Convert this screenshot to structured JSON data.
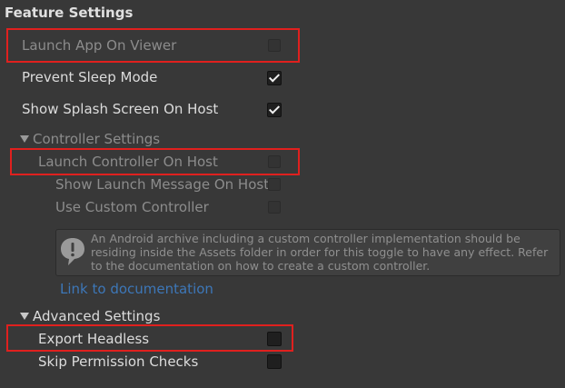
{
  "section_title": "Feature Settings",
  "rows": {
    "launch_app_on_viewer": {
      "label": "Launch App On Viewer",
      "checked": false,
      "enabled": false
    },
    "prevent_sleep_mode": {
      "label": "Prevent Sleep Mode",
      "checked": true,
      "enabled": true
    },
    "show_splash_screen": {
      "label": "Show Splash Screen On Host",
      "checked": true,
      "enabled": true
    },
    "launch_controller_on_host": {
      "label": "Launch Controller On Host",
      "checked": false,
      "enabled": false
    },
    "show_launch_message": {
      "label": "Show Launch Message On Host",
      "checked": false,
      "enabled": false
    },
    "use_custom_controller": {
      "label": "Use Custom Controller",
      "checked": false,
      "enabled": false
    },
    "export_headless": {
      "label": "Export Headless",
      "checked": false,
      "enabled": true
    },
    "skip_permission_checks": {
      "label": "Skip Permission Checks",
      "checked": false,
      "enabled": true
    }
  },
  "controller_settings": {
    "label": "Controller Settings",
    "expanded": true
  },
  "advanced_settings": {
    "label": "Advanced Settings",
    "expanded": true
  },
  "helpbox": {
    "icon": "info-icon",
    "text": "An Android archive including a custom controller implementation should be residing inside the Assets folder in order for this toggle to have any effect. Refer to the documentation on how to create a custom controller."
  },
  "link_text": "Link to documentation",
  "colors": {
    "highlight": "#e0201e",
    "link": "#3d77b8",
    "background": "#383838"
  }
}
